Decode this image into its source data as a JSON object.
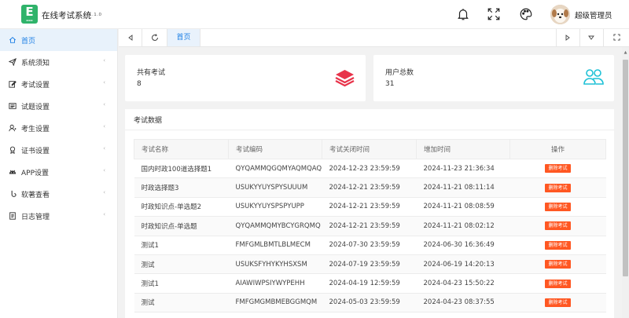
{
  "header": {
    "logo_letter": "E",
    "app_title": "在线考试系统",
    "version": "1.1.0",
    "user_name": "超级管理员"
  },
  "sidebar": {
    "items": [
      {
        "label": "首页",
        "icon": "home-icon",
        "active": true
      },
      {
        "label": "系统须知",
        "icon": "send-icon"
      },
      {
        "label": "考试设置",
        "icon": "edit-icon"
      },
      {
        "label": "试题设置",
        "icon": "book-icon"
      },
      {
        "label": "考生设置",
        "icon": "user-icon"
      },
      {
        "label": "证书设置",
        "icon": "certificate-icon"
      },
      {
        "label": "APP设置",
        "icon": "android-icon"
      },
      {
        "label": "软著查看",
        "icon": "hook-icon"
      },
      {
        "label": "日志管理",
        "icon": "log-icon"
      }
    ]
  },
  "tabs": {
    "home": "首页"
  },
  "stats": {
    "exams_label": "共有考试",
    "exams_value": "8",
    "users_label": "用户总数",
    "users_value": "31"
  },
  "panel": {
    "title": "考试数据",
    "columns": [
      "考试名称",
      "考试编码",
      "考试关闭时间",
      "增加时间",
      "操作"
    ],
    "rows": [
      {
        "name": "国内时政100道选择题1",
        "code": "QYQAMMQGQMYAQMQAQ",
        "close": "2024-12-23 23:59:59",
        "added": "2024-11-23 21:36:34",
        "action": "删除考试"
      },
      {
        "name": "时政选择题3",
        "code": "USUKYYUYSPYSUUUM",
        "close": "2024-12-21 23:59:59",
        "added": "2024-11-21 08:11:14",
        "action": "删除考试"
      },
      {
        "name": "时政知识点-单选题2",
        "code": "USUKYYUYSPSPYUPP",
        "close": "2024-12-21 23:59:59",
        "added": "2024-11-21 08:08:59",
        "action": "删除考试"
      },
      {
        "name": "时政知识点-单选题",
        "code": "QYQAMMQMYBCYGRQMQ",
        "close": "2024-12-21 23:59:59",
        "added": "2024-11-21 08:02:12",
        "action": "删除考试"
      },
      {
        "name": "测试1",
        "code": "FMFGMLBMTLBLMECM",
        "close": "2024-07-30 23:59:59",
        "added": "2024-06-30 16:36:49",
        "action": "删除考试"
      },
      {
        "name": "测试",
        "code": "USUKSFYHYKYHSXSM",
        "close": "2024-07-19 23:59:59",
        "added": "2024-06-19 14:20:13",
        "action": "删除考试"
      },
      {
        "name": "测试1",
        "code": "AIAWIWPSIYWYPEHH",
        "close": "2024-04-19 12:59:59",
        "added": "2024-04-23 15:50:22",
        "action": "删除考试"
      },
      {
        "name": "测试",
        "code": "FMFGMGMBMEBGGMQM",
        "close": "2024-05-03 23:59:59",
        "added": "2024-04-23 08:37:55",
        "action": "删除考试"
      }
    ]
  },
  "colors": {
    "brand_green": "#2fb36a",
    "accent_blue": "#1e80e5",
    "danger": "#ff5722",
    "exam_icon": "#e8334a",
    "user_icon": "#1ec1d6"
  }
}
